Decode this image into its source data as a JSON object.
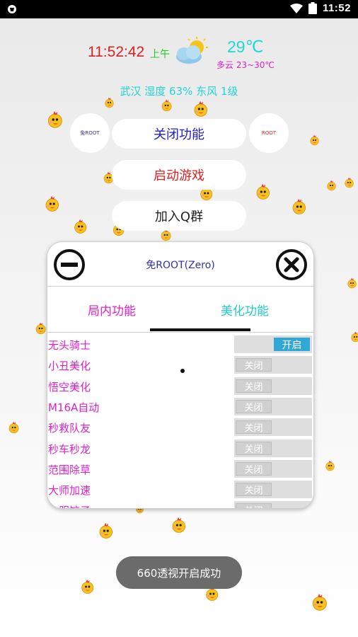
{
  "status_bar": {
    "time": "11:52"
  },
  "header": {
    "clock": "11:52:42",
    "ampm": "上午",
    "temperature": "29℃",
    "condition": "多云 23~30℃",
    "location_line": "武汉 湿度 63% 东风 1级",
    "weather_icon": "partly-cloudy-icon"
  },
  "buttons": {
    "left_circle": "免ROOT",
    "right_circle": "ROOT",
    "close_features": "关闭功能",
    "start_game": "启动游戏",
    "join_group": "加入Q群"
  },
  "panel": {
    "title": "免ROOT(Zero)",
    "tabs": [
      {
        "label": "局内功能",
        "active": false
      },
      {
        "label": "美化功能",
        "active": true
      }
    ],
    "items": [
      {
        "name": "无头骑士",
        "state": "开启",
        "on": true
      },
      {
        "name": "小丑美化",
        "state": "关闭",
        "on": false
      },
      {
        "name": "悟空美化",
        "state": "关闭",
        "on": false
      },
      {
        "name": "M16A自动",
        "state": "关闭",
        "on": false
      },
      {
        "name": "秒救队友",
        "state": "关闭",
        "on": false
      },
      {
        "name": "秒车秒龙",
        "state": "关闭",
        "on": false
      },
      {
        "name": "范围除草",
        "state": "关闭",
        "on": false
      },
      {
        "name": "大师加速",
        "state": "关闭",
        "on": false
      },
      {
        "name": "一服饺子",
        "state": "关闭",
        "on": false
      }
    ]
  },
  "toast": "660透视开启成功",
  "colors": {
    "clock": "#e02020",
    "temp": "#22d7d7",
    "condition": "#e020d0",
    "toggle_on": "#2fa8d8",
    "item_text": "#e020d0"
  }
}
